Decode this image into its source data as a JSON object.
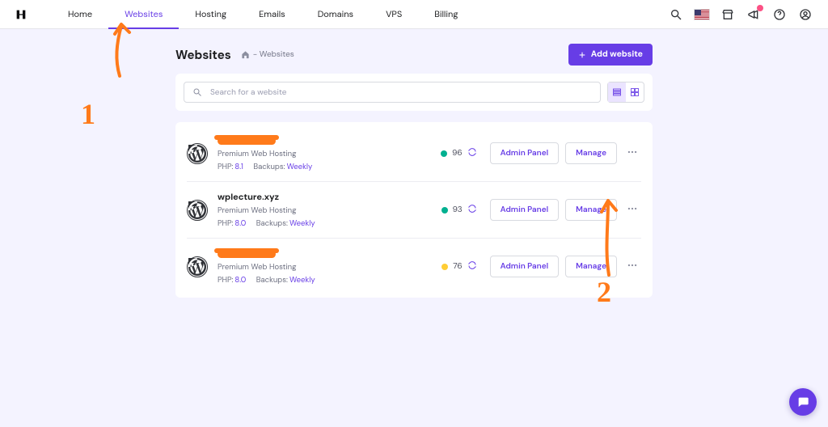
{
  "nav": {
    "tabs": [
      "Home",
      "Websites",
      "Hosting",
      "Emails",
      "Domains",
      "VPS",
      "Billing"
    ],
    "active_index": 1
  },
  "header": {
    "title": "Websites",
    "breadcrumb_trail": "  -  Websites",
    "add_button": "Add website"
  },
  "search": {
    "placeholder": "Search for a website"
  },
  "view": {
    "list_active": true,
    "grid_active": false
  },
  "sites": [
    {
      "name_hidden": true,
      "name": "",
      "plan": "Premium Web Hosting",
      "php_label": "PHP:",
      "php": "8.1",
      "backups_label": "Backups:",
      "backups": "Weekly",
      "score": "96",
      "score_color": "green",
      "admin_btn": "Admin Panel",
      "manage_btn": "Manage"
    },
    {
      "name_hidden": false,
      "name": "wplecture.xyz",
      "plan": "Premium Web Hosting",
      "php_label": "PHP:",
      "php": "8.0",
      "backups_label": "Backups:",
      "backups": "Weekly",
      "score": "93",
      "score_color": "green",
      "admin_btn": "Admin Panel",
      "manage_btn": "Manage"
    },
    {
      "name_hidden": true,
      "name": "",
      "plan": "Premium Web Hosting",
      "php_label": "PHP:",
      "php": "8.0",
      "backups_label": "Backups:",
      "backups": "Weekly",
      "score": "76",
      "score_color": "yellow",
      "admin_btn": "Admin Panel",
      "manage_btn": "Manage"
    }
  ],
  "annotations": {
    "label1": "1",
    "label2": "2"
  },
  "icons": {
    "search": "search-icon",
    "flag": "flag-us-icon",
    "store": "store-icon",
    "announce": "megaphone-icon",
    "help": "help-icon",
    "account": "account-icon",
    "home": "home-icon",
    "plus": "plus-icon",
    "list": "list-view-icon",
    "grid": "grid-view-icon",
    "wordpress": "wordpress-icon",
    "refresh": "refresh-icon",
    "more": "more-icon",
    "chat": "chat-icon"
  }
}
